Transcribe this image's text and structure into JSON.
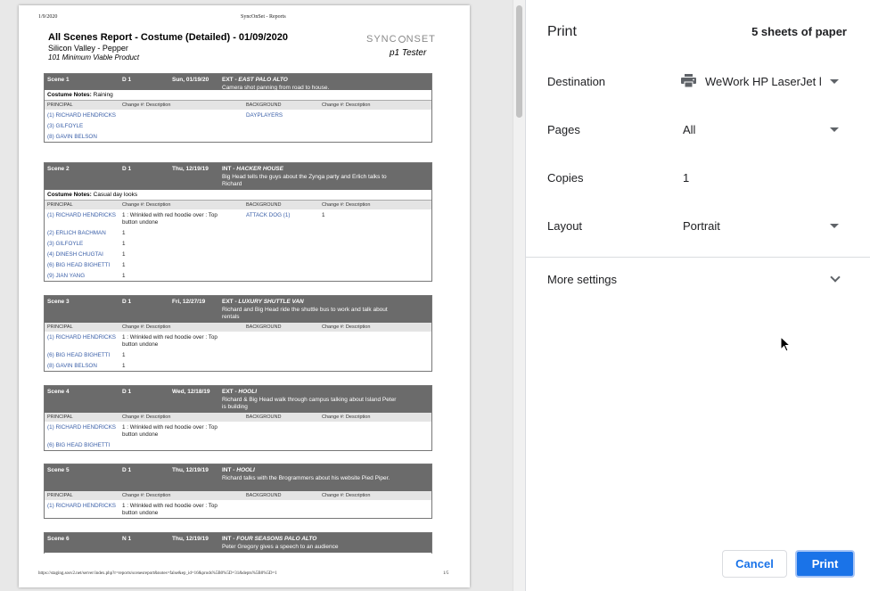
{
  "report": {
    "header_date": "1/9/2020",
    "header_center": "SyncOnSet - Reports",
    "title": "All Scenes Report - Costume (Detailed) - 01/09/2020",
    "subtitle": "Silicon Valley - Pepper",
    "episode": "101 Minimum Viable Product",
    "logo_text_a": "SYNC",
    "logo_text_b": "NSET",
    "user": "p1 Tester",
    "footer_url": "https://staging.sosv2.net/server/index.php?r=reports/scenesreport&notes=false&ep_id=16&prods%5B0%5D=31&depts%5B0%5D=1",
    "footer_page": "1/5",
    "col_principal": "PRINCIPAL",
    "col_change": "Change #: Description",
    "col_background": "BACKGROUND",
    "notes_label": "Costume Notes:",
    "scenes": [
      {
        "scene": "Scene 1",
        "dn": "D 1",
        "date": "Sun, 01/19/20",
        "loc_prefix": "EXT - ",
        "loc": "EAST PALO ALTO",
        "desc": "Camera shot panning from road to house.",
        "notes": "Raining",
        "principals": [
          {
            "name": "(1) RICHARD HENDRICKS",
            "change": ""
          },
          {
            "name": "(3) GILFOYLE",
            "change": ""
          },
          {
            "name": "(8) GAVIN BELSON",
            "change": ""
          }
        ],
        "background": [
          {
            "name": "DAYPLAYERS",
            "change": ""
          }
        ]
      },
      {
        "scene": "Scene 2",
        "dn": "D 1",
        "date": "Thu, 12/19/19",
        "loc_prefix": "INT - ",
        "loc": "HACKER HOUSE",
        "desc": "Big Head tells the guys about the Zynga party and Erlich talks to Richard",
        "notes": "Casual day looks",
        "principals": [
          {
            "name": "(1) RICHARD HENDRICKS",
            "change": "1 : Wrinkled with red hoodie over : Top button undone"
          },
          {
            "name": "(2) ERLICH BACHMAN",
            "change": "1"
          },
          {
            "name": "(3) GILFOYLE",
            "change": "1"
          },
          {
            "name": "(4) DINESH CHUGTAI",
            "change": "1"
          },
          {
            "name": "(6) BIG HEAD BIGHETTI",
            "change": "1"
          },
          {
            "name": "(9) JIAN YANG",
            "change": "1"
          }
        ],
        "background": [
          {
            "name": "ATTACK DOG (1)",
            "change": "1"
          }
        ]
      },
      {
        "scene": "Scene 3",
        "dn": "D 1",
        "date": "Fri, 12/27/19",
        "loc_prefix": "EXT - ",
        "loc": "LUXURY SHUTTLE VAN",
        "desc": "Richard and Big Head ride the shuttle bus to work and talk about rentals",
        "notes": "",
        "principals": [
          {
            "name": "(1) RICHARD HENDRICKS",
            "change": "1 : Wrinkled with red hoodie over : Top button undone"
          },
          {
            "name": "(6) BIG HEAD BIGHETTI",
            "change": "1"
          },
          {
            "name": "(8) GAVIN BELSON",
            "change": "1"
          }
        ],
        "background": []
      },
      {
        "scene": "Scene 4",
        "dn": "D 1",
        "date": "Wed, 12/18/19",
        "loc_prefix": "EXT - ",
        "loc": "HOOLI",
        "desc": "Richard & Big Head walk through campus talking about Island Peter is building",
        "notes": "",
        "principals": [
          {
            "name": "(1) RICHARD HENDRICKS",
            "change": "1 : Wrinkled with red hoodie over : Top button undone"
          },
          {
            "name": "(6) BIG HEAD BIGHETTI",
            "change": ""
          }
        ],
        "background": []
      },
      {
        "scene": "Scene 5",
        "dn": "D 1",
        "date": "Thu, 12/19/19",
        "loc_prefix": "INT - ",
        "loc": "HOOLI",
        "desc": "Richard talks with the Brogrammers about his website Pied Piper.",
        "notes": "",
        "principals": [
          {
            "name": "(1) RICHARD HENDRICKS",
            "change": "1 : Wrinkled with red hoodie over : Top button undone"
          }
        ],
        "background": []
      },
      {
        "scene": "Scene 6",
        "dn": "N 1",
        "date": "Thu, 12/19/19",
        "loc_prefix": "INT - ",
        "loc": "FOUR SEASONS PALO ALTO",
        "desc": "Peter Gregory gives a speech to an audience",
        "notes": "",
        "principals": [],
        "background": []
      }
    ]
  },
  "panel": {
    "title": "Print",
    "sheets": "5 sheets of paper",
    "destination_label": "Destination",
    "destination_value": "WeWork HP LaserJet l",
    "pages_label": "Pages",
    "pages_value": "All",
    "copies_label": "Copies",
    "copies_value": "1",
    "layout_label": "Layout",
    "layout_value": "Portrait",
    "more_settings": "More settings",
    "cancel": "Cancel",
    "print": "Print",
    "accent": "#1a73e8"
  }
}
